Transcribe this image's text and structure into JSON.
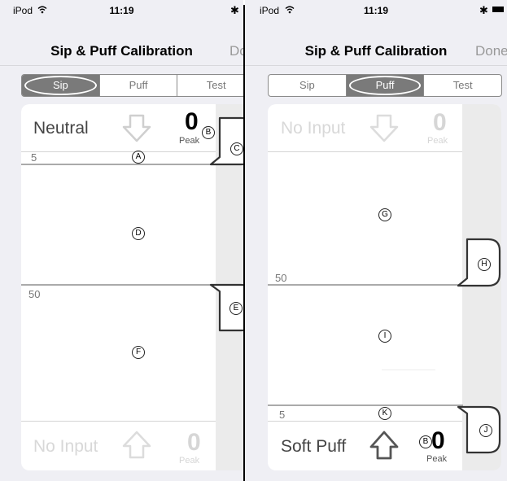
{
  "left": {
    "status": {
      "carrier": "iPod",
      "time": "11:19"
    },
    "nav": {
      "title": "Sip & Puff Calibration",
      "done": "Don"
    },
    "tabs": [
      {
        "label": "Sip",
        "active": true
      },
      {
        "label": "Puff",
        "active": false
      },
      {
        "label": "Test",
        "active": false
      }
    ],
    "top_state": "Neutral",
    "top_peak": "0",
    "top_peak_label": "Peak",
    "marker_a_value": "5",
    "marker_e_value": "50",
    "bottom_state": "No Input",
    "bottom_peak": "0",
    "bottom_peak_label": "Peak",
    "callouts": {
      "a": "A",
      "b": "B",
      "c": "C",
      "d": "D",
      "e": "E",
      "f": "F"
    }
  },
  "right": {
    "status": {
      "carrier": "iPod",
      "time": "11:19"
    },
    "nav": {
      "title": "Sip & Puff Calibration",
      "done": "Done"
    },
    "tabs": [
      {
        "label": "Sip",
        "active": false
      },
      {
        "label": "Puff",
        "active": true
      },
      {
        "label": "Test",
        "active": false
      }
    ],
    "top_state": "No Input",
    "top_peak": "0",
    "top_peak_label": "Peak",
    "marker_h_value": "50",
    "marker_k_value": "5",
    "bottom_state": "Soft Puff",
    "bottom_peak": "0",
    "bottom_peak_label": "Peak",
    "callouts": {
      "b": "B",
      "g": "G",
      "h": "H",
      "i": "I",
      "j": "J",
      "k": "K"
    }
  },
  "icons": {
    "wifi": "wifi-icon",
    "bluetooth": "bluetooth-icon",
    "battery": "battery-icon",
    "arrow_down": "down-arrow-icon",
    "arrow_up": "up-arrow-icon"
  }
}
